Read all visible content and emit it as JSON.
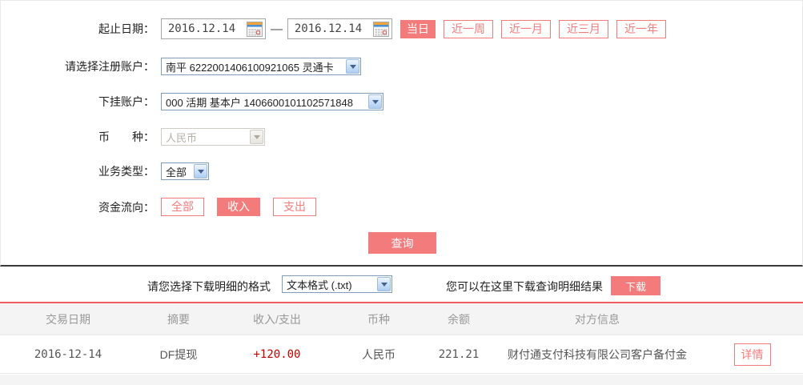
{
  "accent_color": "#f47b7b",
  "form": {
    "date_label": "起止日期：",
    "start_date": "2016.12.14",
    "end_date": "2016.12.14",
    "date_separator": "—",
    "quick_ranges": [
      {
        "label": "当日",
        "active": true
      },
      {
        "label": "近一周",
        "active": false
      },
      {
        "label": "近一月",
        "active": false
      },
      {
        "label": "近三月",
        "active": false
      },
      {
        "label": "近一年",
        "active": false
      }
    ],
    "register_account_label": "请选择注册账户：",
    "register_account_value": "南平 6222001406100921065 灵通卡",
    "sub_account_label": "下挂账户：",
    "sub_account_value": "000 活期 基本户 1406600101102571848",
    "currency_label": "币　　种：",
    "currency_value": "人民币",
    "business_type_label": "业务类型：",
    "business_type_value": "全部",
    "fund_flow_label": "资金流向：",
    "fund_flow_options": [
      {
        "label": "全部",
        "active": false
      },
      {
        "label": "收入",
        "active": true
      },
      {
        "label": "支出",
        "active": false
      }
    ],
    "query_button": "查询"
  },
  "download": {
    "format_label": "请您选择下载明细的格式",
    "format_value": "文本格式 (.txt)",
    "hint": "您可以在这里下载查询明细结果",
    "download_button": "下载"
  },
  "table": {
    "headers": [
      "交易日期",
      "摘要",
      "收入/支出",
      "币种",
      "余额",
      "对方信息"
    ],
    "rows": [
      {
        "date": "2016-12-14",
        "summary": "DF提现",
        "amount": "+120.00",
        "currency": "人民币",
        "balance": "221.21",
        "counterparty": "财付通支付科技有限公司客户备付金",
        "detail_button": "详情"
      }
    ]
  }
}
